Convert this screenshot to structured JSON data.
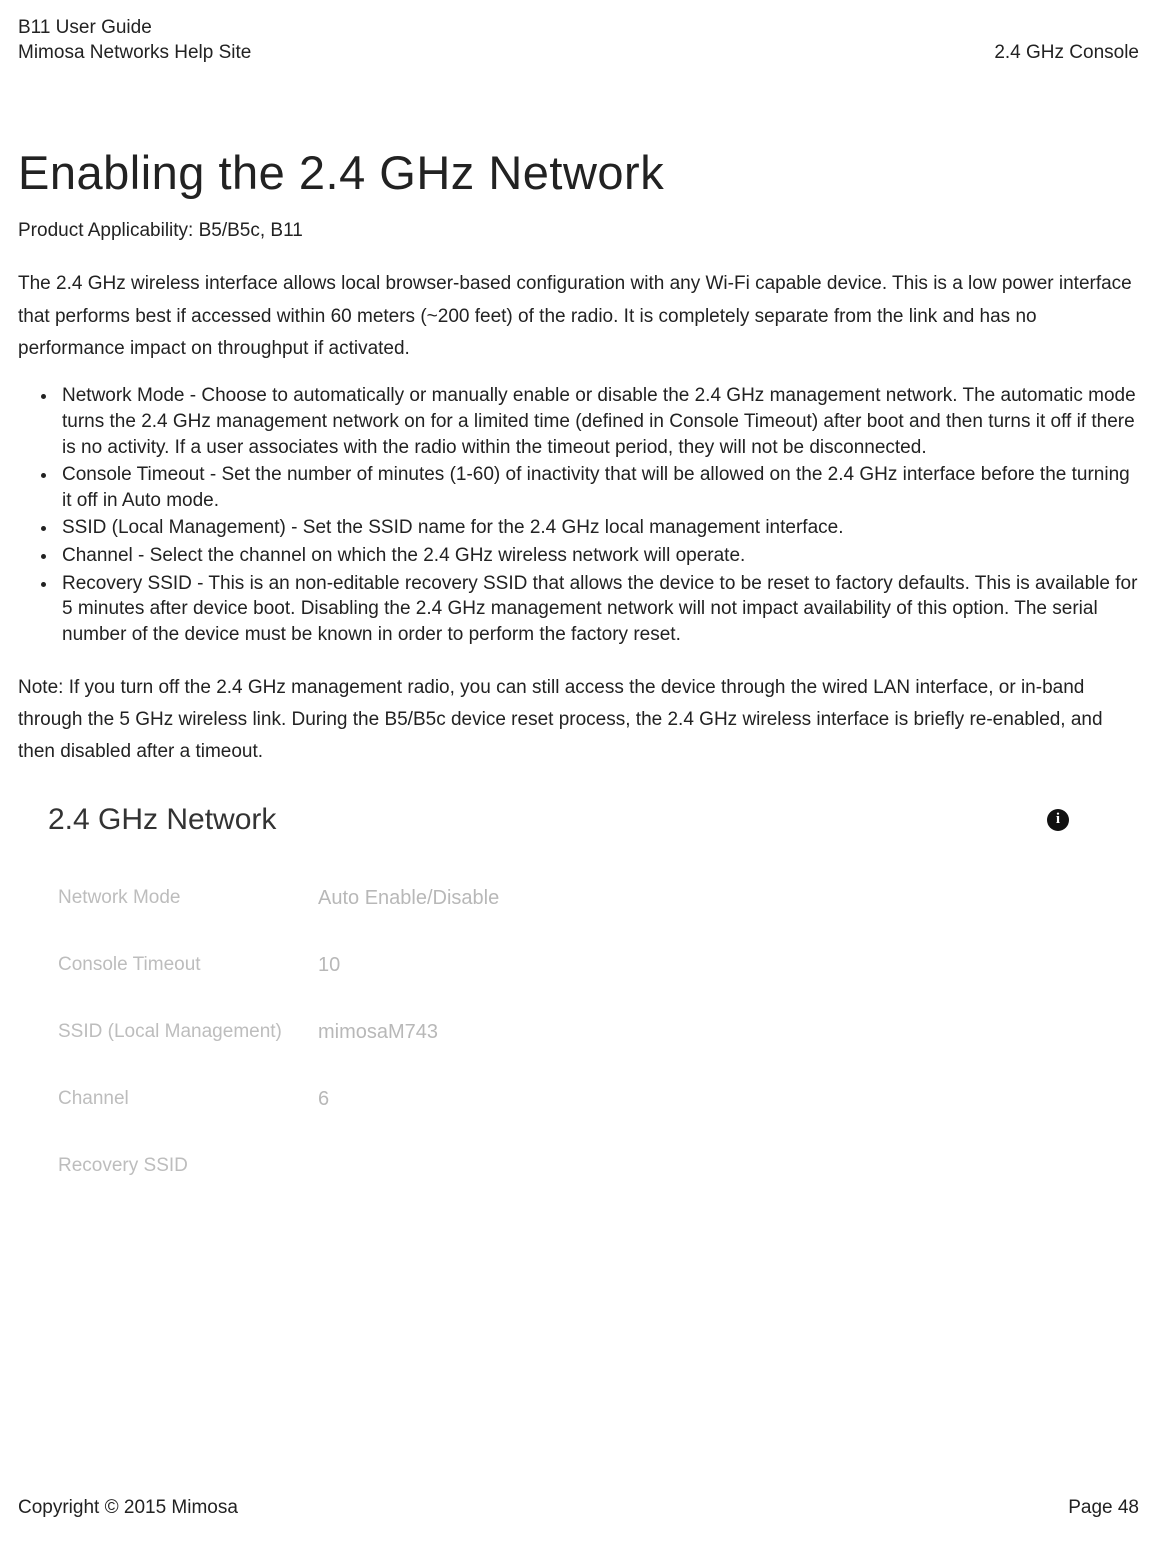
{
  "header": {
    "title_line1": "B11 User Guide",
    "title_line2": "Mimosa Networks Help Site",
    "section": "2.4 GHz Console"
  },
  "page": {
    "heading": "Enabling the 2.4 GHz Network",
    "applicability": "Product Applicability: B5/B5c, B11",
    "para1": "The 2.4 GHz wireless interface allows local browser-based configuration with any Wi-Fi capable device. This is a low power interface that performs best if accessed within 60 meters (~200 feet) of the radio. It is completely separate from the link and has no performance impact on throughput if activated.",
    "bullets": [
      "Network Mode - Choose to automatically or manually enable or disable the 2.4 GHz management network. The automatic mode turns the 2.4 GHz management network on for a limited time (defined in Console Timeout) after boot and then turns it off if there is no activity. If a user associates with the radio within the timeout period, they will not be disconnected.",
      "Console Timeout - Set the number of minutes (1-60) of inactivity that will be allowed on the 2.4 GHz interface before the turning it off in Auto mode.",
      "SSID (Local Management) - Set the SSID name for the 2.4 GHz local management interface.",
      "Channel - Select the channel on which the 2.4 GHz wireless network will operate.",
      "Recovery SSID - This is an non-editable recovery SSID that allows the device to be reset to factory defaults. This is available for 5 minutes after device boot. Disabling the 2.4 GHz management network will not impact availability of this option. The serial number of the device must be known in order to perform the factory reset."
    ],
    "note": "Note: If you turn off the 2.4 GHz management radio, you can still access the device through the wired LAN interface, or in-band through the 5 GHz wireless link. During the B5/B5c device reset process, the 2.4 GHz wireless interface is briefly re-enabled, and then disabled after a timeout."
  },
  "panel": {
    "title": "2.4 GHz Network",
    "info_glyph": "i",
    "fields": [
      {
        "label": "Network Mode",
        "value": "Auto Enable/Disable"
      },
      {
        "label": "Console Timeout",
        "value": "10"
      },
      {
        "label": "SSID (Local Management)",
        "value": "mimosaM743"
      },
      {
        "label": "Channel",
        "value": "6"
      },
      {
        "label": "Recovery SSID",
        "value": ""
      }
    ]
  },
  "footer": {
    "copyright": "Copyright © 2015 Mimosa",
    "page": "Page 48"
  }
}
